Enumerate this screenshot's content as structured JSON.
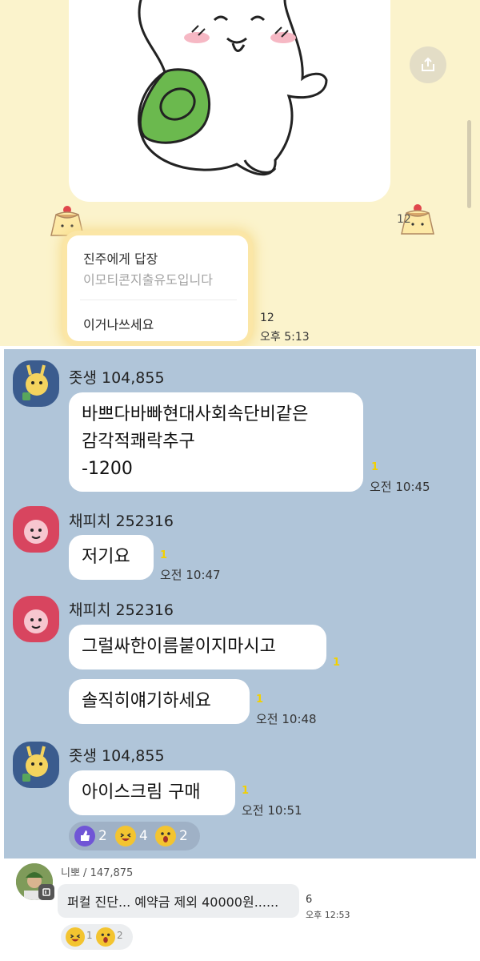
{
  "panel1": {
    "sticker_count": "12",
    "reply": {
      "title": "진주에게 답장",
      "quote": "이모티콘지출유도입니다",
      "text": "이거나쓰세요",
      "unread": "12",
      "time": "오후 5:13"
    }
  },
  "panel2": {
    "messages": [
      {
        "sender": "좃생 104,855",
        "lines": [
          "바쁘다바빠현대사회속단비같은",
          "감각적쾌락추구",
          "-1200"
        ],
        "unread": "1",
        "time": "오전 10:45"
      },
      {
        "sender": "채피치 252316",
        "text": "저기요",
        "unread": "1",
        "time": "오전 10:47"
      },
      {
        "sender": "채피치 252316",
        "texts": [
          "그럴싸한이름붙이지마시고",
          "솔직히얘기하세요"
        ],
        "unreads": [
          "1",
          "1"
        ],
        "time": "오전 10:48"
      },
      {
        "sender": "좃생 104,855",
        "text": "아이스크림 구매",
        "unread": "1",
        "time": "오전 10:51"
      }
    ],
    "reactions": [
      {
        "icon": "thumbs-up-icon",
        "count": "2"
      },
      {
        "icon": "laughing-face-icon",
        "count": "4"
      },
      {
        "icon": "surprised-face-icon",
        "count": "2"
      }
    ]
  },
  "comment": {
    "name": "니뽀 / 147,875",
    "text": "퍼컬 진단... 예약금 제외 40000원......",
    "count": "6",
    "time": "오후 12:53",
    "reactions": [
      {
        "icon": "laughing-face-icon",
        "count": "1"
      },
      {
        "icon": "surprised-face-icon",
        "count": "2"
      }
    ]
  },
  "colors": {
    "yellow_bg": "#fbf3cc",
    "blue_bg": "#b0c5d9",
    "unread_yellow": "#f2d000"
  }
}
